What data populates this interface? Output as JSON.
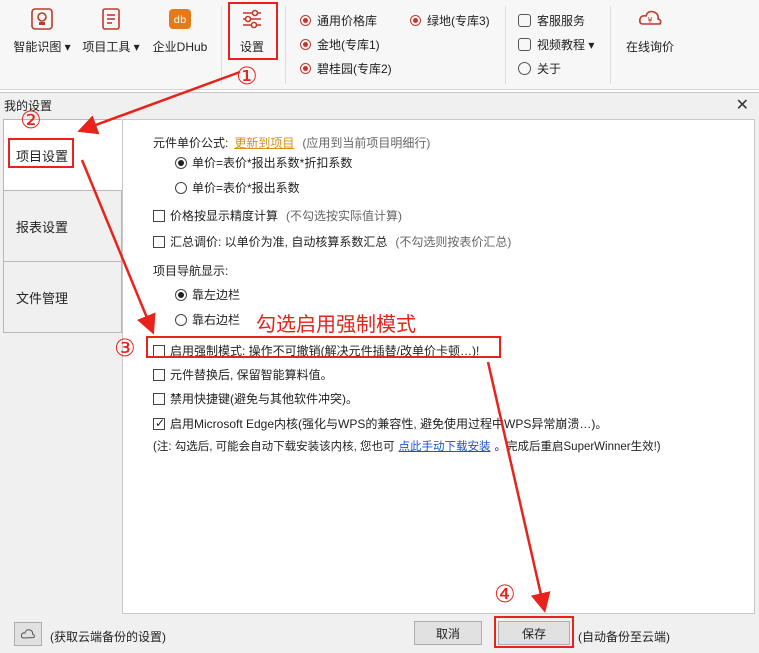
{
  "ribbon": {
    "buttons": [
      {
        "label": "智能识图 ▾",
        "icon": "smart-image-icon"
      },
      {
        "label": "项目工具 ▾",
        "icon": "project-tools-icon"
      },
      {
        "label": "企业DHub",
        "icon": "dhub-icon"
      },
      {
        "label": "设置",
        "icon": "settings-sliders-icon"
      }
    ],
    "libraries": [
      "通用价格库",
      "金地(专库1)",
      "碧桂园(专库2)",
      "绿地(专库3)"
    ],
    "services": [
      {
        "label": "客服服务",
        "icon": "chat-icon"
      },
      {
        "label": "视频教程 ▾",
        "icon": "video-icon"
      },
      {
        "label": "关于",
        "icon": "info-icon"
      }
    ],
    "online": {
      "label": "在线询价",
      "icon": "price-inquiry-icon"
    }
  },
  "dialog": {
    "title": "我的设置",
    "close": "✕",
    "nav": [
      "项目设置",
      "报表设置",
      "文件管理"
    ],
    "unit_price_label": "元件单价公式:",
    "update_link": "更新到项目",
    "update_hint": "(应用到当前项目明细行)",
    "formula_a": "单价=表价*报出系数*折扣系数",
    "formula_b": "单价=表价*报出系数",
    "precision": "价格按显示精度计算",
    "precision_hint": "(不勾选按实际值计算)",
    "summary": "汇总调价: 以单价为准, 自动核算系数汇总",
    "summary_hint": "(不勾选则按表价汇总)",
    "nav_display": "项目导航显示:",
    "nav_left": "靠左边栏",
    "nav_right": "靠右边栏",
    "force_mode": "启用强制模式: 操作不可撤销(解决元件插替/改单价卡顿…)!",
    "keep_calc": "元件替换后, 保留智能算料值。",
    "disable_hotkey": "禁用快捷键(避免与其他软件冲突)。",
    "edge_core": "启用Microsoft Edge内核(强化与WPS的兼容性, 避免使用过程中WPS异常崩溃…)。",
    "note_prefix": "(注: 勾选后, 可能会自动下载安装该内核, 您也可",
    "note_link": "点此手动下载安装",
    "note_suffix": "。完成后重启SuperWinner生效!)",
    "cloud_text": "(获取云端备份的设置)",
    "cancel": "取消",
    "save": "保存",
    "save_hint": "(自动备份至云端)"
  },
  "annotations": {
    "steps": [
      "①",
      "②",
      "③",
      "④"
    ],
    "callout": "勾选启用强制模式",
    "color": "#e8231b"
  }
}
